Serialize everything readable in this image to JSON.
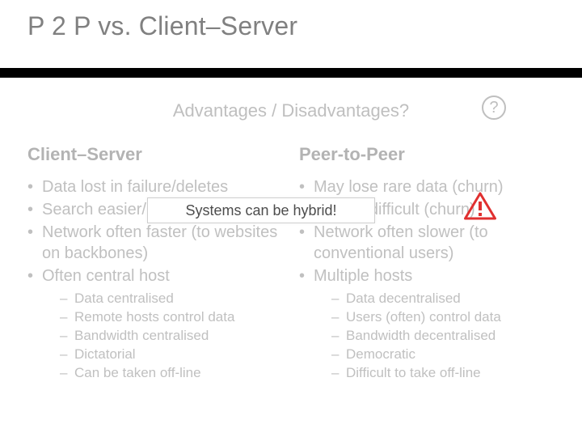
{
  "title": "P 2 P vs. Client–Server",
  "subq": "Advantages / Disadvantages?",
  "qmark": "?",
  "left": {
    "heading": "Client–Server",
    "b1": "Data lost in failure/deletes",
    "b2": "Search easier/hybrid",
    "b3": "Network often faster (to websites on backbones)",
    "b4": "Often central host",
    "s1": "Data centralised",
    "s2": "Remote hosts control data",
    "s3": "Bandwidth centralised",
    "s4": "Dictatorial",
    "s5": "Can be taken off-line"
  },
  "right": {
    "heading": "Peer-to-Peer",
    "b1": "May lose rare data (churn)",
    "b2": "Search difficult (churn)",
    "b3": "Network often slower (to conventional users)",
    "b4": "Multiple hosts",
    "s1": "Data decentralised",
    "s2": "Users (often) control data",
    "s3": "Bandwidth decentralised",
    "s4": "Democratic",
    "s5": "Difficult to take off-line"
  },
  "callout": "Systems can be hybrid!"
}
